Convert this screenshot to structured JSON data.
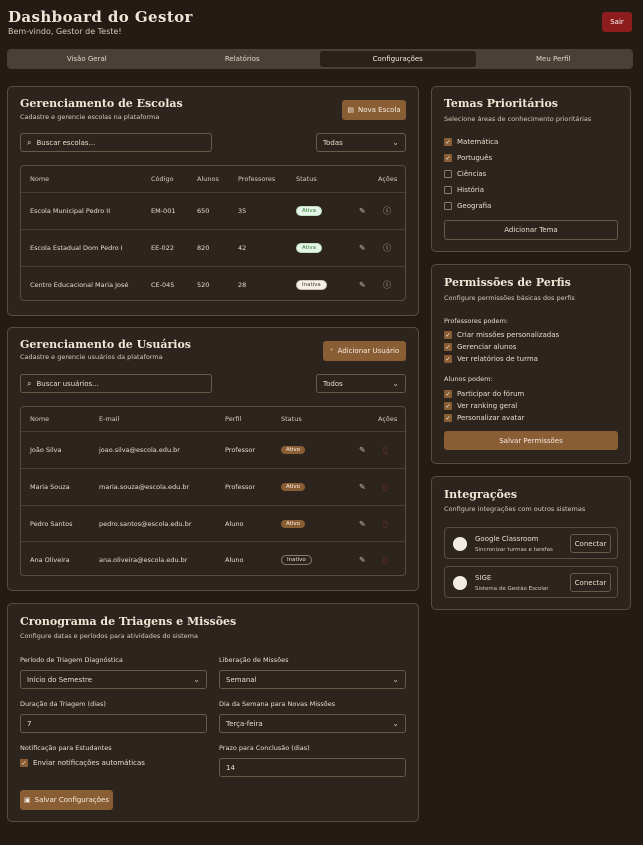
{
  "header": {
    "title": "Dashboard do Gestor",
    "subtitle": "Bem-vindo, Gestor de Teste!",
    "logout": "Sair"
  },
  "tabs": [
    "Visão Geral",
    "Relatórios",
    "Configurações",
    "Meu Perfil"
  ],
  "schools": {
    "title": "Gerenciamento de Escolas",
    "subtitle": "Cadastre e gerencie escolas na plataforma",
    "add_button": "Nova Escola",
    "search_placeholder": "Buscar escolas...",
    "filter": "Todas",
    "columns": [
      "Nome",
      "Código",
      "Alunos",
      "Professores",
      "Status",
      "Ações"
    ],
    "rows": [
      {
        "name": "Escola Municipal Pedro II",
        "code": "EM-001",
        "students": "650",
        "teachers": "35",
        "status": "Ativa"
      },
      {
        "name": "Escola Estadual Dom Pedro I",
        "code": "EE-022",
        "students": "820",
        "teachers": "42",
        "status": "Ativa"
      },
      {
        "name": "Centro Educacional Maria José",
        "code": "CE-045",
        "students": "520",
        "teachers": "28",
        "status": "Inativa"
      }
    ]
  },
  "users": {
    "title": "Gerenciamento de Usuários",
    "subtitle": "Cadastre e gerencie usuários da plataforma",
    "add_button": "Adicionar Usuário",
    "search_placeholder": "Buscar usuários...",
    "filter": "Todos",
    "columns": [
      "Nome",
      "E-mail",
      "Perfil",
      "Status",
      "Ações"
    ],
    "rows": [
      {
        "name": "João Silva",
        "email": "joao.silva@escola.edu.br",
        "role": "Professor",
        "status": "Ativo"
      },
      {
        "name": "Maria Souza",
        "email": "maria.souza@escola.edu.br",
        "role": "Professor",
        "status": "Ativo"
      },
      {
        "name": "Pedro Santos",
        "email": "pedro.santos@escola.edu.br",
        "role": "Aluno",
        "status": "Ativo"
      },
      {
        "name": "Ana Oliveira",
        "email": "ana.oliveira@escola.edu.br",
        "role": "Aluno",
        "status": "Inativo"
      }
    ]
  },
  "schedule": {
    "title": "Cronograma de Triagens e Missões",
    "subtitle": "Configure datas e períodos para atividades do sistema",
    "triage_period_label": "Período de Triagem Diagnóstica",
    "triage_period_value": "Início do Semestre",
    "mission_release_label": "Liberação de Missões",
    "mission_release_value": "Semanal",
    "triage_duration_label": "Duração da Triagem (dias)",
    "triage_duration_value": "7",
    "weekday_label": "Dia da Semana para Novas Missões",
    "weekday_value": "Terça-feira",
    "notify_label": "Notificação para Estudantes",
    "notify_checkbox": "Enviar notificações automáticas",
    "deadline_label": "Prazo para Conclusão (dias)",
    "deadline_value": "14",
    "save_button": "Salvar Configurações"
  },
  "topics": {
    "title": "Temas Prioritários",
    "subtitle": "Selecione áreas de conhecimento prioritárias",
    "items": [
      {
        "label": "Matemática",
        "checked": true
      },
      {
        "label": "Português",
        "checked": true
      },
      {
        "label": "Ciências",
        "checked": false
      },
      {
        "label": "História",
        "checked": false
      },
      {
        "label": "Geografia",
        "checked": false
      }
    ],
    "add_button": "Adicionar Tema"
  },
  "permissions": {
    "title": "Permissões de Perfis",
    "subtitle": "Configure permissões básicas dos perfis",
    "teachers_label": "Professores podem:",
    "teachers": [
      "Criar missões personalizadas",
      "Gerenciar alunos",
      "Ver relatórios de turma"
    ],
    "students_label": "Alunos podem:",
    "students": [
      "Participar do fórum",
      "Ver ranking geral",
      "Personalizar avatar"
    ],
    "save_button": "Salvar Permissões"
  },
  "integrations": {
    "title": "Integrações",
    "subtitle": "Configure integrações com outros sistemas",
    "items": [
      {
        "name": "Google Classroom",
        "desc": "Sincronizar turmas e tarefas",
        "button": "Conectar"
      },
      {
        "name": "SIGE",
        "desc": "Sistema de Gestão Escolar",
        "button": "Conectar"
      }
    ]
  },
  "colors": {
    "background": "#231b14",
    "card": "#2c241d",
    "accent": "#8a5e35",
    "danger": "#8d1c1c"
  }
}
